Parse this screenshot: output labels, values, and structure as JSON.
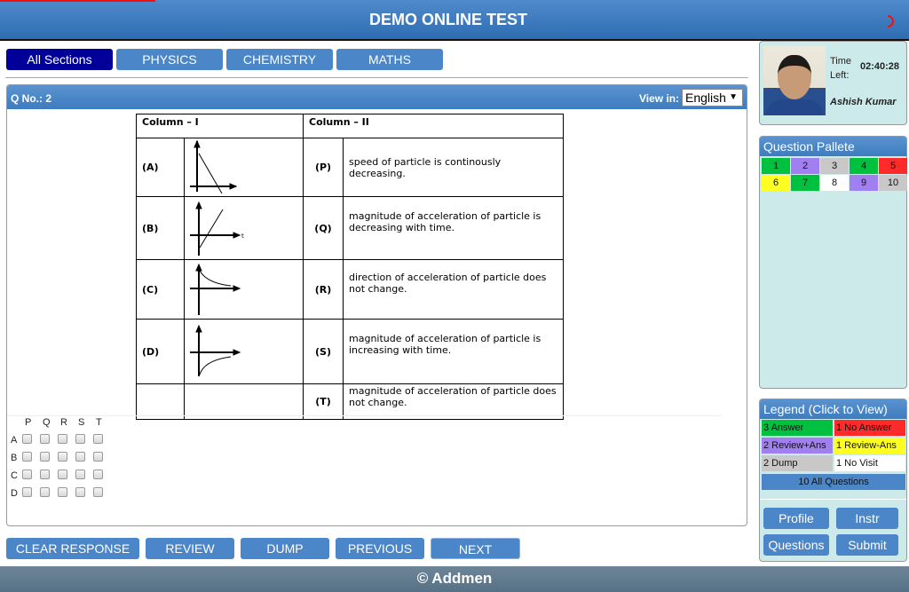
{
  "header": {
    "title": "DEMO ONLINE TEST"
  },
  "sections": [
    {
      "label": "All Sections",
      "active": true
    },
    {
      "label": "PHYSICS"
    },
    {
      "label": "CHEMISTRY"
    },
    {
      "label": "MATHS"
    }
  ],
  "question": {
    "number_label": "Q No.: 2",
    "view_in_label": "View in:",
    "language": "English",
    "col1_header": "Column – I",
    "col2_header": "Column – II",
    "rows": [
      {
        "left": "(A)",
        "graph": "v-t line decreasing",
        "right": "(P)",
        "text": "speed of particle is continously decreasing."
      },
      {
        "left": "(B)",
        "graph": "v-t line increasing",
        "right": "(Q)",
        "text": "magnitude of acceleration of particle is decreasing with time."
      },
      {
        "left": "(C)",
        "graph": "v-t curve decaying positive",
        "right": "(R)",
        "text": "direction of acceleration of particle does not change."
      },
      {
        "left": "(D)",
        "graph": "v-t curve rising negative",
        "right": "(S)",
        "text": "magnitude of acceleration of particle is increasing with time."
      },
      {
        "left": "",
        "graph": "",
        "right": "(T)",
        "text": "magnitude of acceleration of particle does not change."
      }
    ],
    "graph_axis_labels": {
      "v": "v",
      "t": "t"
    },
    "matrix": {
      "cols": [
        "P",
        "Q",
        "R",
        "S",
        "T"
      ],
      "rows": [
        "A",
        "B",
        "C",
        "D"
      ]
    }
  },
  "actions": {
    "clear": "CLEAR RESPONSE",
    "review": "REVIEW",
    "dump": "DUMP",
    "previous": "PREVIOUS",
    "next": "NEXT"
  },
  "footer": {
    "text": "© Addmen"
  },
  "profile": {
    "time_label": "Time Left:",
    "time_left": "02:40:28",
    "name": "Ashish Kumar"
  },
  "pallete": {
    "title": "Question Pallete",
    "items": [
      {
        "n": "1",
        "color": "#00c040"
      },
      {
        "n": "2",
        "color": "#a080f0"
      },
      {
        "n": "3",
        "color": "#c8c8c8"
      },
      {
        "n": "4",
        "color": "#00c040"
      },
      {
        "n": "5",
        "color": "#ff2a2a"
      },
      {
        "n": "6",
        "color": "#ffff22"
      },
      {
        "n": "7",
        "color": "#00c040"
      },
      {
        "n": "8",
        "color": "#ffffff"
      },
      {
        "n": "9",
        "color": "#a080f0"
      },
      {
        "n": "10",
        "color": "#c8c8c8"
      }
    ]
  },
  "legend": {
    "title": "Legend (Click to View)",
    "items": [
      {
        "label": "3 Answer",
        "color": "#00c040"
      },
      {
        "label": "1 No Answer",
        "color": "#ff2a2a"
      },
      {
        "label": "2 Review+Ans",
        "color": "#a080f0"
      },
      {
        "label": "1 Review-Ans",
        "color": "#ffff22"
      },
      {
        "label": "2 Dump",
        "color": "#c8c8c8"
      },
      {
        "label": "1 No Visit",
        "color": "#ffffff"
      }
    ],
    "all": "10 All Questions"
  },
  "side_buttons": {
    "profile": "Profile",
    "instr": "Instr",
    "questions": "Questions",
    "submit": "Submit"
  }
}
